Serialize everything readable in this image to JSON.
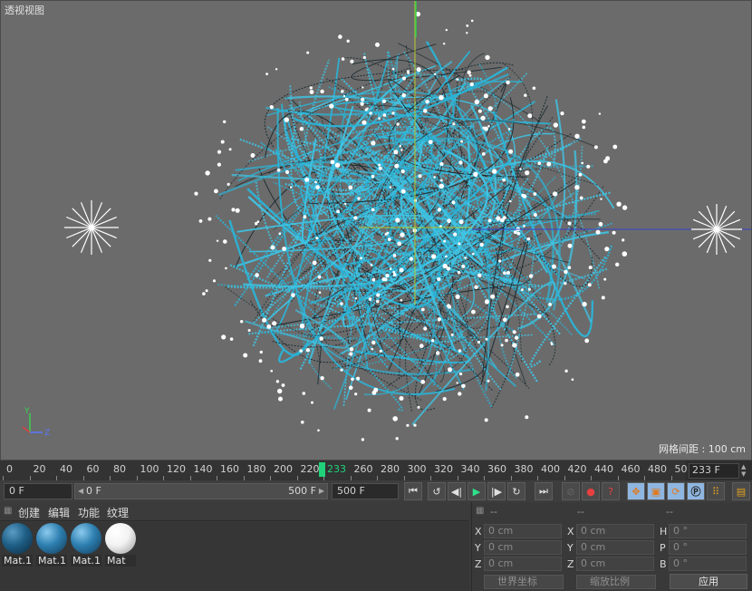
{
  "viewport": {
    "title": "透视视图",
    "grid_label": "网格间距 : 100 cm",
    "axis_labels": [
      "Y",
      "Z"
    ]
  },
  "timeline": {
    "ticks": [
      "0",
      "20",
      "40",
      "60",
      "80",
      "100",
      "120",
      "140",
      "160",
      "180",
      "200",
      "220",
      "233",
      "260",
      "280",
      "300",
      "320",
      "340",
      "360",
      "380",
      "400",
      "420",
      "440",
      "460",
      "480",
      "50"
    ],
    "current_frame": "233 F"
  },
  "playback": {
    "start_field": "0 F",
    "range_start": "0 F",
    "range_end": "500 F",
    "end_field": "500 F"
  },
  "material_menu": [
    "创建",
    "编辑",
    "功能",
    "纹理"
  ],
  "materials": [
    {
      "label": "Mat.1",
      "color": "#1f5f86"
    },
    {
      "label": "Mat.1",
      "color": "#2d7fb0"
    },
    {
      "label": "Mat.1",
      "color": "#2d7fb0"
    },
    {
      "label": "Mat",
      "color": "#f2f2f2"
    }
  ],
  "coordinates": {
    "headers": [
      "--",
      "--",
      "--"
    ],
    "rows": [
      [
        {
          "axis": "X",
          "value": "0 cm"
        },
        {
          "axis": "X",
          "value": "0 cm"
        },
        {
          "axis": "H",
          "value": "0 °"
        }
      ],
      [
        {
          "axis": "Y",
          "value": "0 cm"
        },
        {
          "axis": "Y",
          "value": "0 cm"
        },
        {
          "axis": "P",
          "value": "0 °"
        }
      ],
      [
        {
          "axis": "Z",
          "value": "0 cm"
        },
        {
          "axis": "Z",
          "value": "0 cm"
        },
        {
          "axis": "B",
          "value": "0 °"
        }
      ]
    ],
    "mode_dropdown": "世界坐标",
    "scale_dropdown": "缩放比例",
    "apply_label": "应用"
  },
  "colors": {
    "accent_green": "#1fd27a",
    "strand_cyan": "#2bb3d6",
    "viewport_bg": "#6b6b6b"
  }
}
